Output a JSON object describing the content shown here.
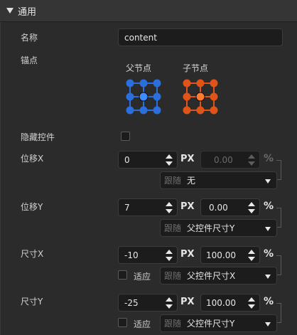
{
  "header": {
    "title": "通用"
  },
  "name": {
    "label": "名称",
    "value": "content"
  },
  "anchor": {
    "label": "锚点",
    "parent_label": "父节点",
    "child_label": "子节点",
    "parent_color": "#2a6fdc",
    "parent_selected_color": "#3d8bff",
    "child_color": "#e0541a",
    "child_selected_color": "#ff7a2e",
    "parent_selected": "center",
    "child_selected": "center"
  },
  "hide": {
    "label": "隐藏控件"
  },
  "pos_x": {
    "label": "位移X",
    "px_value": "0",
    "unit": "PX",
    "pct_value": "0.00",
    "pct_unit": "%",
    "follow_prefix": "跟随",
    "follow_value": "无"
  },
  "pos_y": {
    "label": "位移Y",
    "px_value": "7",
    "unit": "PX",
    "pct_value": "0.00",
    "pct_unit": "%",
    "follow_prefix": "跟随",
    "follow_value": "父控件尺寸Y"
  },
  "size_x": {
    "label": "尺寸X",
    "px_value": "-10",
    "unit": "PX",
    "pct_value": "100.00",
    "pct_unit": "%",
    "adapt_label": "适应",
    "follow_prefix": "跟随",
    "follow_value": "父控件尺寸X"
  },
  "size_y": {
    "label": "尺寸Y",
    "px_value": "-25",
    "unit": "PX",
    "pct_value": "100.00",
    "pct_unit": "%",
    "adapt_label": "适应",
    "follow_prefix": "跟随",
    "follow_value": "父控件尺寸Y"
  }
}
